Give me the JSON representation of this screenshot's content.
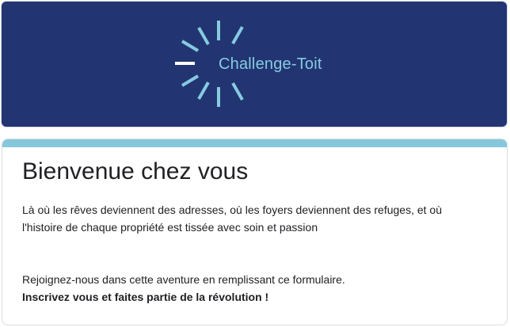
{
  "banner": {
    "logo_text": "Challenge-Toit",
    "logo_icon": "sunburst-loading-icon",
    "background_color": "#223572",
    "logo_color": "#86cbe0"
  },
  "card": {
    "accent_color": "#86c7dc",
    "title": "Bienvenue chez vous",
    "description": "Là où les rêves deviennent des adresses, où les foyers deviennent des refuges, et où l'histoire de chaque propriété est tissée avec soin et passion",
    "join_text": "Rejoignez-nous dans cette aventure en remplissant ce formulaire.",
    "cta_text": "Inscrivez vous et faites partie de la révolution !"
  }
}
